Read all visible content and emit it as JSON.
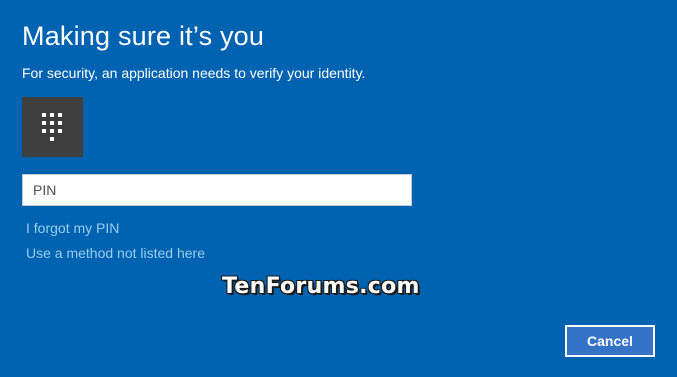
{
  "dialog": {
    "title": "Making sure it’s you",
    "subtitle": "For security, an application needs to verify your identity.",
    "pin_tile_icon": "pin-keypad-icon",
    "pin_input": {
      "placeholder": "PIN",
      "value": ""
    },
    "links": {
      "forgot_pin": "I forgot my PIN",
      "other_method": "Use a method not listed here"
    },
    "watermark": "TenForums.com",
    "cancel_label": "Cancel"
  },
  "colors": {
    "background": "#0063b1",
    "link": "#99ccee",
    "tile": "#3f3f3f",
    "button": "#3573c6"
  }
}
